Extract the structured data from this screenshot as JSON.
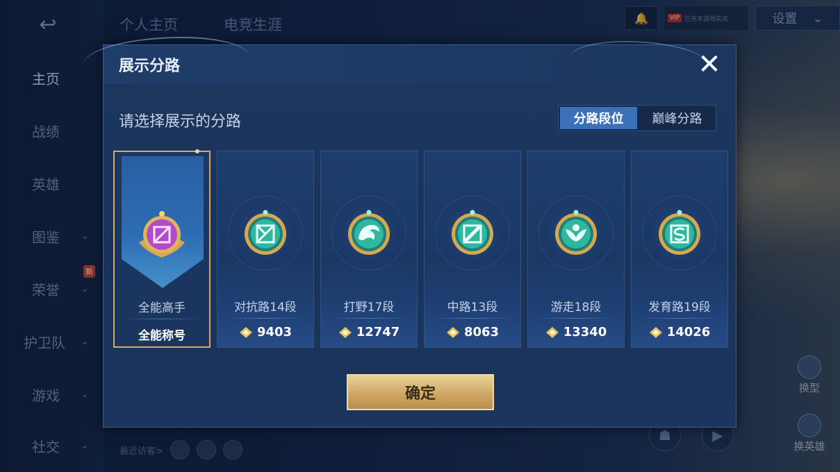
{
  "sidebar": {
    "back_glyph": "↩",
    "items": [
      {
        "label": "主页",
        "chevron": false,
        "active": true
      },
      {
        "label": "战绩",
        "chevron": false
      },
      {
        "label": "英雄",
        "chevron": false
      },
      {
        "label": "图鉴",
        "chevron": true
      },
      {
        "label": "荣誉",
        "chevron": true,
        "badge": "新"
      },
      {
        "label": "护卫队",
        "chevron": true
      },
      {
        "label": "游戏",
        "chevron": true
      },
      {
        "label": "社交",
        "chevron": true
      }
    ]
  },
  "top_tabs": [
    "个人主页",
    "电竞生涯"
  ],
  "top_right": {
    "vip_tag": "VIP",
    "vip_text": "已充本游戏实名",
    "settings_label": "设置"
  },
  "recent_visitors_label": "最近访客>",
  "side_actions": [
    {
      "label": "换型"
    },
    {
      "label": "换英雄"
    }
  ],
  "dialog": {
    "title": "展示分路",
    "close_glyph": "✕",
    "prompt": "请选择展示的分路",
    "toggle": {
      "options": [
        "分路段位",
        "巅峰分路"
      ],
      "active_index": 0
    },
    "cards": [
      {
        "name": "全能高手",
        "tag": "全能称号",
        "selected": true,
        "icon": "all-round-emblem-icon",
        "emblem_color": "#b54ac8"
      },
      {
        "name": "对抗路14段",
        "score": "9403",
        "icon": "clash-lane-emblem-icon",
        "emblem_color": "#2fb7a0"
      },
      {
        "name": "打野17段",
        "score": "12747",
        "icon": "jungle-dragon-emblem-icon",
        "emblem_color": "#2fb7a0"
      },
      {
        "name": "中路13段",
        "score": "8063",
        "icon": "mid-lane-emblem-icon",
        "emblem_color": "#2fb7a0"
      },
      {
        "name": "游走18段",
        "score": "13340",
        "icon": "roam-wings-emblem-icon",
        "emblem_color": "#2fb7a0"
      },
      {
        "name": "发育路19段",
        "score": "14026",
        "icon": "farm-lane-emblem-icon",
        "emblem_color": "#2fb7a0"
      }
    ],
    "confirm_label": "确定"
  },
  "colors": {
    "dialog_bg": "#1c375f",
    "accent_blue": "#3a71b8",
    "gold": "#d8a96a",
    "emblem_teal": "#2fb7a0",
    "emblem_purple": "#b54ac8"
  }
}
